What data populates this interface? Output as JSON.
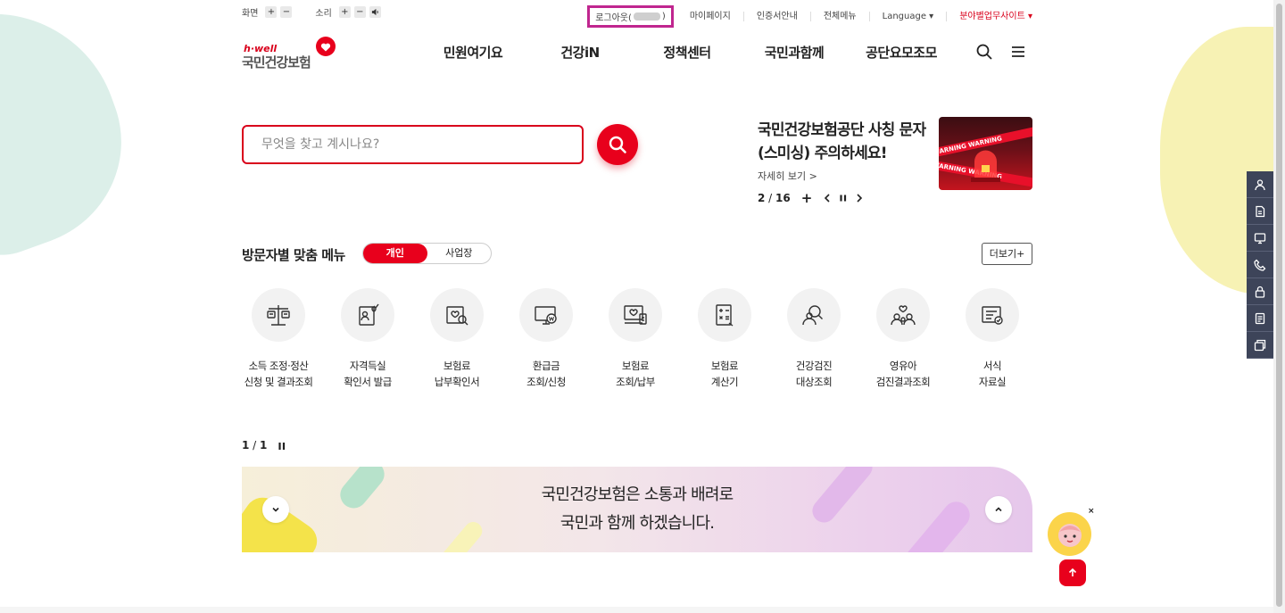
{
  "utility": {
    "screen_label": "화면",
    "sound_label": "소리",
    "plus": "+",
    "minus": "−",
    "logout_label": "로그아웃(",
    "logout_close": ")",
    "links": [
      "마이페이지",
      "인증서안내",
      "전체메뉴",
      "Language ▾"
    ],
    "field_sites": "분야별업무사이트 ▾"
  },
  "logo": {
    "brand": "h·well",
    "name": "국민건강보험"
  },
  "gnb": [
    "민원여기요",
    "건강iN",
    "정책센터",
    "국민과함께",
    "공단요모조모"
  ],
  "search": {
    "placeholder": "무엇을 찾고 계시나요?"
  },
  "notice": {
    "title": "국민건강보험공단 사칭 문자(스미싱) 주의하세요!",
    "more": "자세히 보기 >",
    "current": "2",
    "sep": " / ",
    "total": "16",
    "plus": "+"
  },
  "notice_image": {
    "tape_text": "WARNING WARNING"
  },
  "custom_menu": {
    "title": "방문자별 맞춤 메뉴",
    "tab_personal": "개인",
    "tab_business": "사업장",
    "more": "더보기+",
    "items": [
      {
        "line1": "소득 조정·정산",
        "line2": "신청 및 결과조회",
        "icon": "scale-icon"
      },
      {
        "line1": "자격득실",
        "line2": "확인서 발급",
        "icon": "certificate-icon"
      },
      {
        "line1": "보험료",
        "line2": "납부확인서",
        "icon": "receipt-search-icon"
      },
      {
        "line1": "환급금",
        "line2": "조회/신청",
        "icon": "refund-monitor-icon"
      },
      {
        "line1": "보험료",
        "line2": "조회/납부",
        "icon": "payment-icon"
      },
      {
        "line1": "보험료",
        "line2": "계산기",
        "icon": "calculator-icon"
      },
      {
        "line1": "건강검진",
        "line2": "대상조회",
        "icon": "checkup-search-icon"
      },
      {
        "line1": "영유아",
        "line2": "검진결과조회",
        "icon": "infant-family-icon"
      },
      {
        "line1": "서식",
        "line2": "자료실",
        "icon": "form-document-icon"
      }
    ]
  },
  "banner": {
    "current": "1",
    "sep": " / ",
    "total": "1",
    "line1": "국민건강보험은 소통과 배려로",
    "line2": "국민과 함께 하겠습니다."
  },
  "chatbot": {
    "close": "×"
  },
  "colors": {
    "brand_red": "#e8001c",
    "quick_bg": "#3d4459",
    "highlight": "#c0268f"
  }
}
